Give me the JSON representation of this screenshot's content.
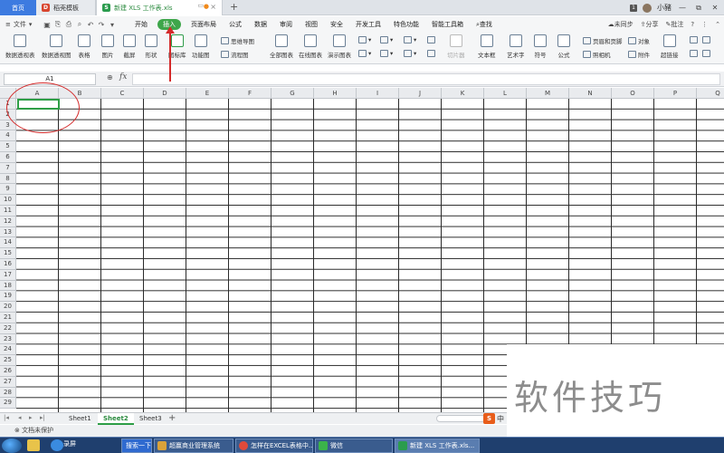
{
  "tabs": {
    "home": "首页",
    "docer": "稻壳模板",
    "file": "新建 XLS 工作表.xls",
    "new_tab": "+"
  },
  "window": {
    "badge": "1",
    "user": "小豬",
    "minimize": "—",
    "restore": "⧉",
    "close": "✕"
  },
  "menu": {
    "file": "文件",
    "tabs": [
      "开始",
      "插入",
      "页面布局",
      "公式",
      "数据",
      "审阅",
      "视图",
      "安全",
      "开发工具",
      "特色功能",
      "智能工具箱"
    ],
    "active_tab": "插入",
    "search": "查找",
    "sync": "未同步",
    "share": "分享",
    "comment": "批注",
    "help": "?"
  },
  "ribbon": {
    "pivot_table": "数据透视表",
    "pivot_chart": "数据透视图",
    "table": "表格",
    "picture": "图片",
    "screenshot": "截屏",
    "shapes": "形状",
    "icons": "图标库",
    "function_chart": "功能图",
    "mindmap": "思维导图",
    "flowchart": "流程图",
    "all_charts": "全部图表",
    "online_charts": "在线图表",
    "presentation_chart": "演示图表",
    "slicer": "切片器",
    "textbox": "文本框",
    "wordart": "艺术字",
    "symbol": "符号",
    "formula": "公式",
    "header_footer": "页眉和页脚",
    "object": "对象",
    "camera": "照相机",
    "attachment": "附件",
    "hyperlink": "超链接"
  },
  "formula_bar": {
    "cell_ref": "A1",
    "fx": "fx",
    "value": ""
  },
  "columns": [
    "A",
    "B",
    "C",
    "D",
    "E",
    "F",
    "G",
    "H",
    "I",
    "J",
    "K",
    "L",
    "M",
    "N",
    "O",
    "P",
    "Q"
  ],
  "rows": [
    "1",
    "2",
    "3",
    "4",
    "5",
    "6",
    "7",
    "8",
    "9",
    "10",
    "11",
    "12",
    "13",
    "14",
    "15",
    "16",
    "17",
    "18",
    "19",
    "20",
    "21",
    "22",
    "23",
    "24",
    "25",
    "26",
    "27",
    "28",
    "29"
  ],
  "selected_cell": "A1",
  "sheets": [
    "Sheet1",
    "Sheet2",
    "Sheet3"
  ],
  "active_sheet": "Sheet2",
  "add_sheet": "+",
  "status": {
    "protection": "文档未保护"
  },
  "ime": {
    "logo": "S",
    "lang": "中"
  },
  "watermark": "软件技巧",
  "taskbar": {
    "ie_label": "录屏",
    "items": [
      "搜索一下",
      "超赢商业管理系统",
      "怎样在EXCEL表格中...",
      "微信",
      "新建 XLS 工作表.xls..."
    ],
    "active_item": "新建 XLS 工作表.xls..."
  },
  "colors": {
    "accent_green": "#3ea64a",
    "annotation_red": "#d42a2a",
    "home_tab_blue": "#3d7be0",
    "taskbar": "#1f3f6e"
  }
}
